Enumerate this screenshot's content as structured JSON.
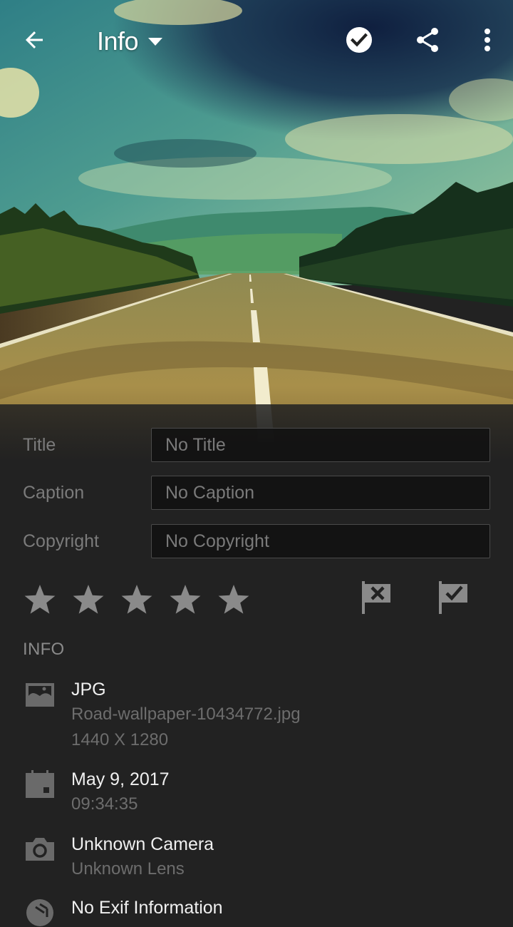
{
  "appbar": {
    "title": "Info",
    "back_icon": "arrow-left-icon",
    "dropdown_icon": "caret-down-icon",
    "actions": [
      {
        "name": "done",
        "icon": "check-circle-icon"
      },
      {
        "name": "share",
        "icon": "share-icon"
      },
      {
        "name": "more",
        "icon": "more-vertical-icon"
      }
    ]
  },
  "photo": {
    "description": "Road wallpaper: empty asphalt road leading to green mountains under cloudy sky"
  },
  "metadata_fields": {
    "title": {
      "label": "Title",
      "value": "",
      "placeholder": "No Title"
    },
    "caption": {
      "label": "Caption",
      "value": "",
      "placeholder": "No Caption"
    },
    "copyright": {
      "label": "Copyright",
      "value": "",
      "placeholder": "No Copyright"
    }
  },
  "rating": {
    "max_stars": 5,
    "value": 0,
    "reject_flag_icon": "flag-reject-icon",
    "pick_flag_icon": "flag-pick-icon"
  },
  "info": {
    "heading": "INFO",
    "file": {
      "icon": "image-icon",
      "type": "JPG",
      "filename": "Road-wallpaper-10434772.jpg",
      "dimensions": "1440 X 1280"
    },
    "date": {
      "icon": "calendar-icon",
      "date": "May 9, 2017",
      "time": "09:34:35"
    },
    "camera": {
      "icon": "camera-icon",
      "camera": "Unknown Camera",
      "lens": "Unknown Lens"
    },
    "exif": {
      "icon": "aperture-icon",
      "text": "No Exif Information"
    }
  },
  "colors": {
    "panel_bg": "#222222",
    "label_gray": "#7b7b7b",
    "icon_gray": "#8a8a8a",
    "primary_text": "#f0f0f0",
    "secondary_text": "#6d6d6d"
  }
}
